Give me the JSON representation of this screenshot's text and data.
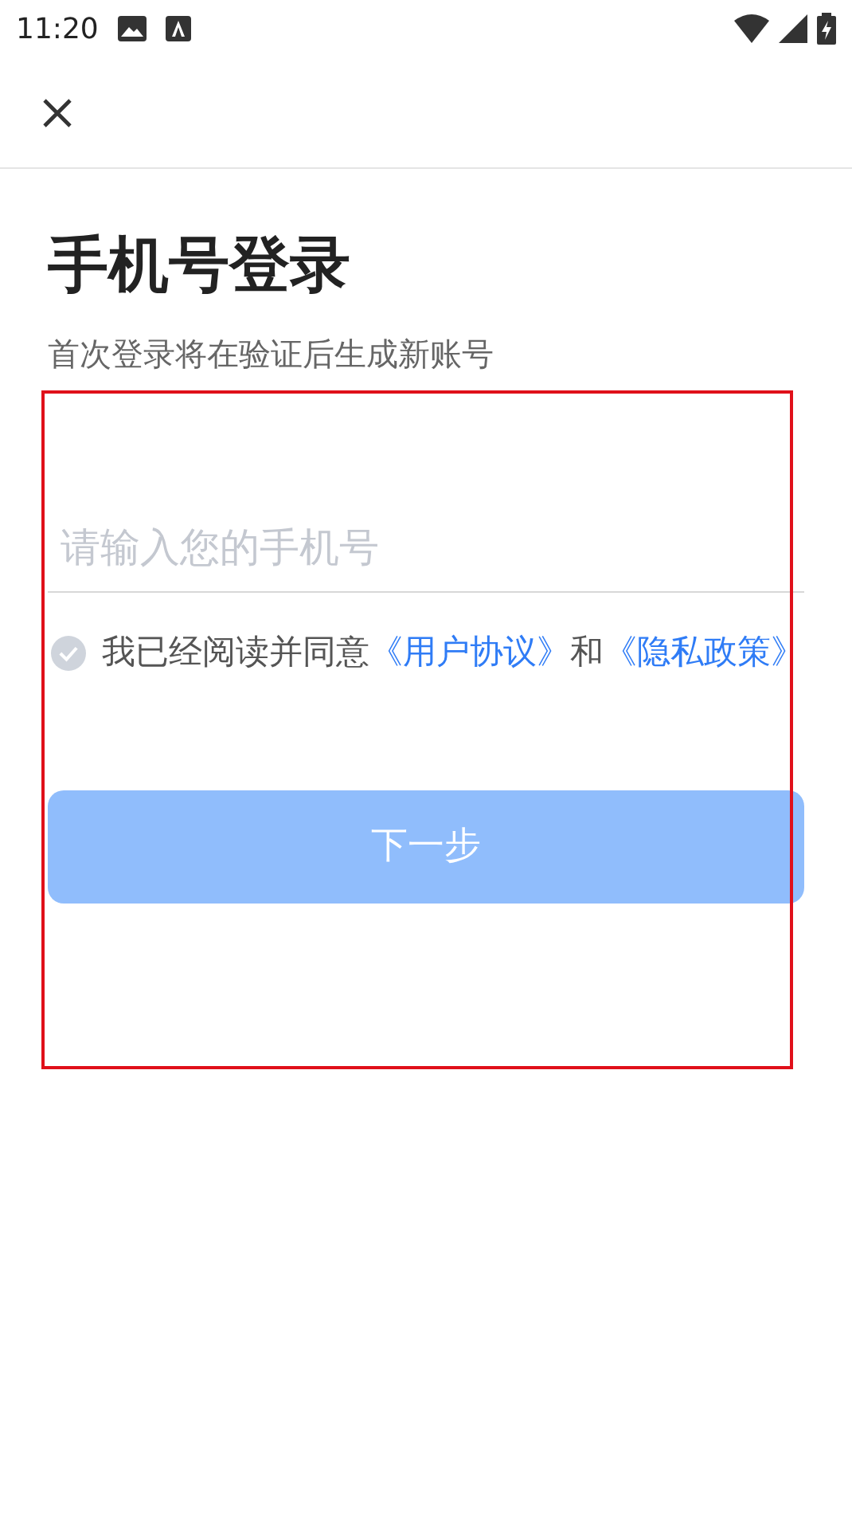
{
  "status_bar": {
    "time": "11:20"
  },
  "title": "手机号登录",
  "subtitle": "首次登录将在验证后生成新账号",
  "phone_field": {
    "placeholder": "请输入您的手机号"
  },
  "agreement": {
    "checked": false,
    "parts": [
      {
        "kind": "text",
        "text": "我已经阅读并同意"
      },
      {
        "kind": "link",
        "text": "《用户协议》"
      },
      {
        "kind": "text",
        "text": "和"
      },
      {
        "kind": "link",
        "text": "《隐私政策》"
      }
    ]
  },
  "next_button": {
    "label": "下一步",
    "disabled": true
  }
}
